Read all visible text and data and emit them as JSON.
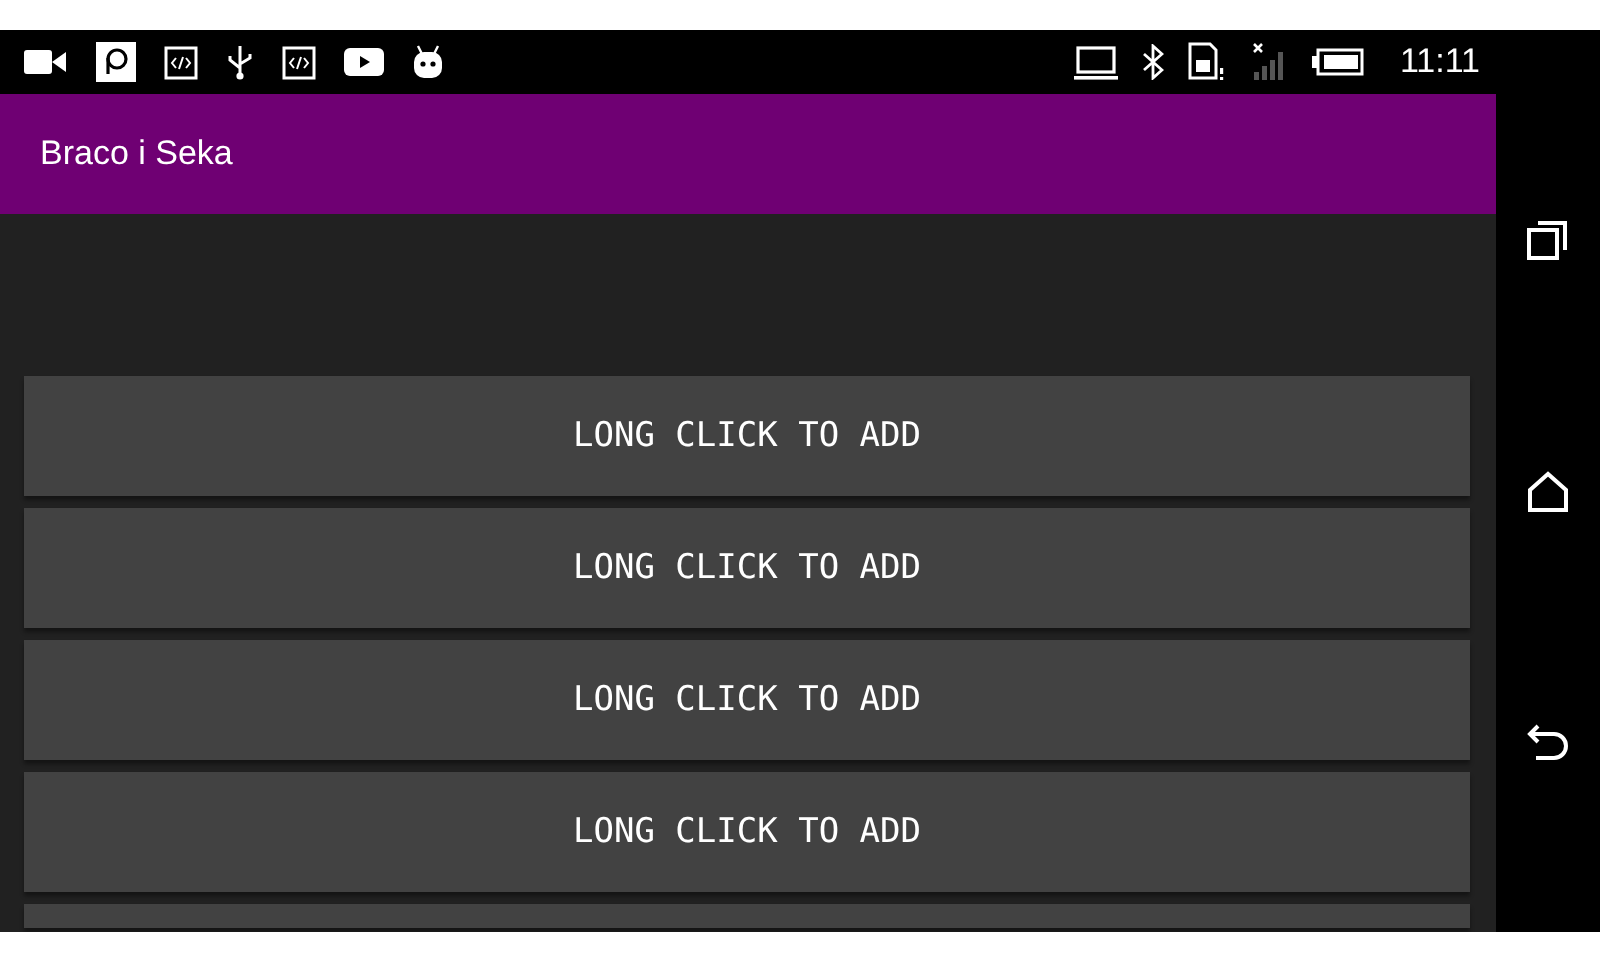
{
  "status_bar": {
    "time": "11:11"
  },
  "app_bar": {
    "title": "Braco i Seka"
  },
  "buttons": [
    {
      "kind": "full",
      "label": "LONG CLICK TO ADD"
    },
    {
      "kind": "full",
      "label": "LONG CLICK TO ADD"
    },
    {
      "kind": "full",
      "label": "LONG CLICK TO ADD"
    },
    {
      "kind": "full",
      "label": "LONG CLICK TO ADD"
    },
    {
      "kind": "cut"
    }
  ]
}
